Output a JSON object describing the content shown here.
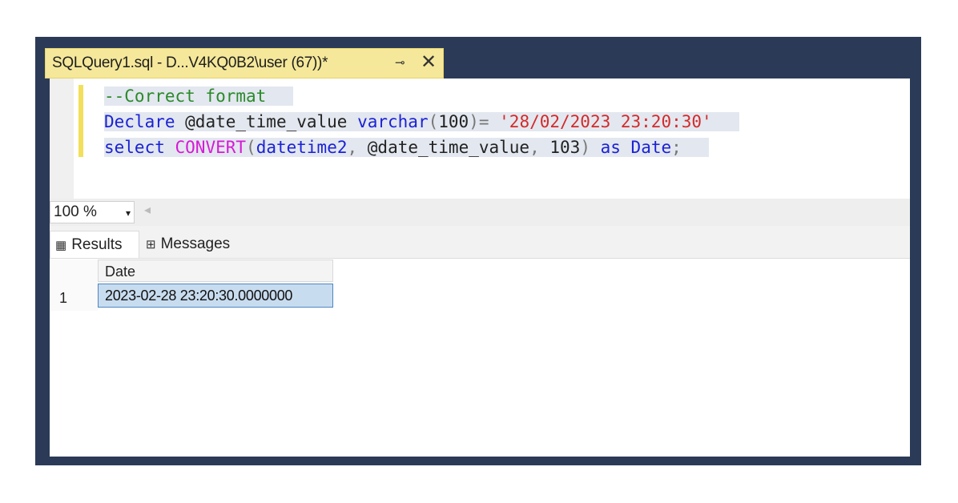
{
  "window": {
    "tab_title": "SQLQuery1.sql - D...V4KQ0B2\\user (67))*",
    "pin_glyph": "⊸",
    "close_glyph": "✕"
  },
  "editor": {
    "lines": [
      [
        {
          "t": "--Correct format",
          "c": "k-cmt"
        }
      ],
      [
        {
          "t": "Declare ",
          "c": "k-kw"
        },
        {
          "t": "@date_time_value ",
          "c": "k-var"
        },
        {
          "t": "varchar",
          "c": "k-kw"
        },
        {
          "t": "(",
          "c": "k-gray"
        },
        {
          "t": "100",
          "c": "k-var"
        },
        {
          "t": ")",
          "c": "k-gray"
        },
        {
          "t": "= ",
          "c": "k-gray"
        },
        {
          "t": "'28/02/2023 23:20:30'",
          "c": "k-str"
        }
      ],
      [
        {
          "t": "select ",
          "c": "k-kw"
        },
        {
          "t": "CONVERT",
          "c": "k-fn"
        },
        {
          "t": "(",
          "c": "k-gray"
        },
        {
          "t": "datetime2",
          "c": "k-kw"
        },
        {
          "t": ", ",
          "c": "k-gray"
        },
        {
          "t": "@date_time_value",
          "c": "k-var"
        },
        {
          "t": ", ",
          "c": "k-gray"
        },
        {
          "t": "103",
          "c": "k-var"
        },
        {
          "t": ") ",
          "c": "k-gray"
        },
        {
          "t": "as ",
          "c": "k-kw"
        },
        {
          "t": "Date",
          "c": "k-kw"
        },
        {
          "t": ";",
          "c": "k-gray"
        }
      ]
    ]
  },
  "zoom": {
    "value": "100 %",
    "dropdown_glyph": "▾",
    "scroll_left_glyph": "◂"
  },
  "results": {
    "tabs": [
      {
        "label": "Results",
        "icon": "grid-icon",
        "glyph": "▦"
      },
      {
        "label": "Messages",
        "icon": "messages-icon",
        "glyph": "⊞"
      }
    ],
    "columns": [
      "Date"
    ],
    "rows": [
      {
        "num": "1",
        "values": [
          "2023-02-28 23:20:30.0000000"
        ]
      }
    ]
  },
  "colors": {
    "frame": "#2b3a57",
    "tab_active": "#f5e89a",
    "comment": "#2a8a2a",
    "keyword": "#1a22d6",
    "function": "#d61ad6",
    "string": "#d32a2a",
    "selected_cell": "#c8dcef"
  }
}
